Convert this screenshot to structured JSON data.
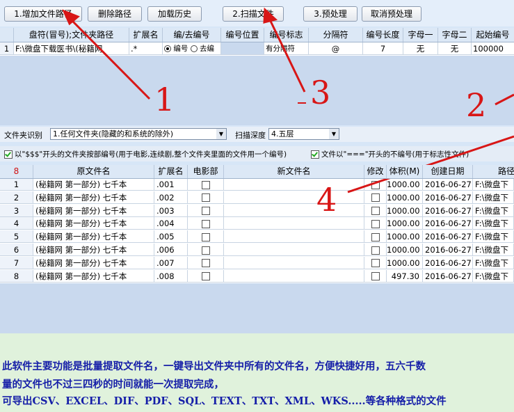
{
  "toolbar": {
    "add_path": "1.增加文件路径",
    "delete_path": "删除路径",
    "load_history": "加载历史",
    "scan_files": "2.扫描文件",
    "preprocess": "3.预处理",
    "cancel_preprocess": "取消预处理"
  },
  "path_grid": {
    "headers": [
      "盘符(冒号);文件夹路径",
      "扩展名",
      "编/去编号",
      "编号位置",
      "编号标志",
      "分隔符",
      "编号长度",
      "字母一",
      "字母二",
      "起始编号"
    ],
    "row": {
      "index": "1",
      "path": "F:\\微盘下载医书\\(秘籍网",
      "ext": ".*",
      "radio_number": "编号",
      "radio_remove": "去编",
      "position": "",
      "flag": "有分隔符",
      "separator": "@",
      "length": "7",
      "letter1": "无",
      "letter2": "无",
      "start": "100000"
    }
  },
  "options": {
    "folder_id_label": "文件夹识别",
    "folder_id_value": "1.任何文件夹(隐藏的和系统的除外)",
    "depth_label": "扫描深度",
    "depth_value": "4.五层",
    "check1_label": "以\"$$$\"开头的文件夹按部编号(用于电影,连续剧,整个文件夹里面的文件用一个编号)",
    "check2_label": "文件以\"===\"开头的不编号(用于标志性文件)"
  },
  "file_grid": {
    "count": "8",
    "headers": [
      "原文件名",
      "扩展名",
      "电影部",
      "新文件名",
      "修改",
      "体积(M)",
      "创建日期",
      "路径"
    ],
    "rows": [
      {
        "i": "1",
        "name": "(秘籍网  第一部分)   七千本",
        "ext": ".001",
        "size": "1000.00",
        "date": "2016-06-27",
        "path": "F:\\微盘下"
      },
      {
        "i": "2",
        "name": "(秘籍网  第一部分)   七千本",
        "ext": ".002",
        "size": "1000.00",
        "date": "2016-06-27",
        "path": "F:\\微盘下"
      },
      {
        "i": "3",
        "name": "(秘籍网  第一部分)   七千本",
        "ext": ".003",
        "size": "1000.00",
        "date": "2016-06-27",
        "path": "F:\\微盘下"
      },
      {
        "i": "4",
        "name": "(秘籍网  第一部分)   七千本",
        "ext": ".004",
        "size": "1000.00",
        "date": "2016-06-27",
        "path": "F:\\微盘下"
      },
      {
        "i": "5",
        "name": "(秘籍网  第一部分)   七千本",
        "ext": ".005",
        "size": "1000.00",
        "date": "2016-06-27",
        "path": "F:\\微盘下"
      },
      {
        "i": "6",
        "name": "(秘籍网  第一部分)   七千本",
        "ext": ".006",
        "size": "1000.00",
        "date": "2016-06-27",
        "path": "F:\\微盘下"
      },
      {
        "i": "7",
        "name": "(秘籍网  第一部分)   七千本",
        "ext": ".007",
        "size": "1000.00",
        "date": "2016-06-27",
        "path": "F:\\微盘下"
      },
      {
        "i": "8",
        "name": "(秘籍网  第一部分)   七千本",
        "ext": ".008",
        "size": "497.30",
        "date": "2016-06-27",
        "path": "F:\\微盘下"
      }
    ]
  },
  "annotations": {
    "n1": "1",
    "n2": "2",
    "n3": "3",
    "n4": "4",
    "color": "#d81616"
  },
  "footer": {
    "line1": "此软件主要功能是批量提取文件名，一键导出文件夹中所有的文件名，方便快捷好用，五六千数",
    "line2": "量的文件也不过三四秒的时间就能一次提取完成，",
    "line3": "可导出CSV、EXCEL、DIF、PDF、SQL、TEXT、TXT、XML、WKS.....等各种格式的文件"
  }
}
